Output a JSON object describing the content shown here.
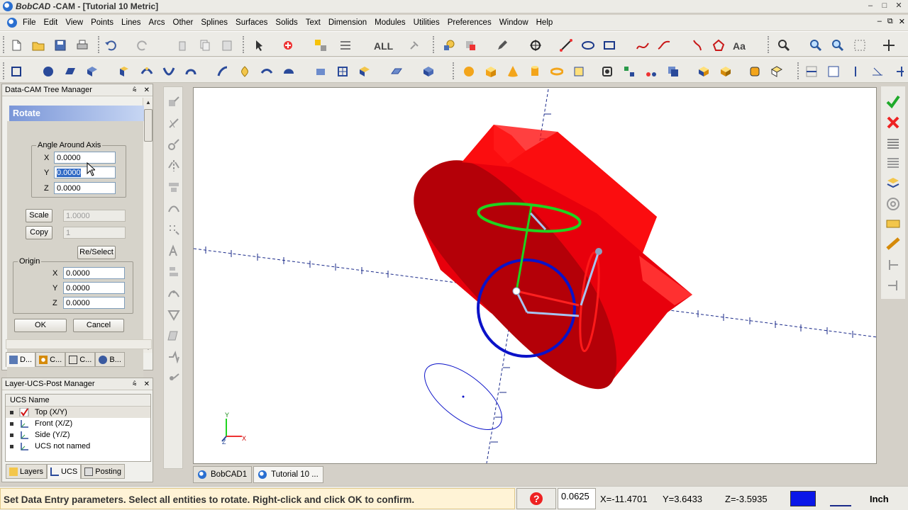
{
  "window": {
    "app_name": "BobCAD",
    "title_rest": " -CAM - [Tutorial 10 Metric]",
    "controls": [
      "–",
      "□",
      "✕"
    ],
    "mdi_controls": [
      "–",
      "⧉",
      "✕"
    ]
  },
  "menu": [
    "File",
    "Edit",
    "View",
    "Points",
    "Lines",
    "Arcs",
    "Other",
    "Splines",
    "Surfaces",
    "Solids",
    "Text",
    "Dimension",
    "Modules",
    "Utilities",
    "Preferences",
    "Window",
    "Help"
  ],
  "toolbar": {
    "all_label": "ALL",
    "text_label": "Aa"
  },
  "tree_manager": {
    "title": "Data-CAM Tree Manager",
    "pin": "⩯",
    "close": "✕",
    "rotate_title": "Rotate",
    "angle_group": "Angle Around Axis",
    "angle": {
      "x_label": "X",
      "x_value": "0.0000",
      "y_label": "Y",
      "y_value": "0.0000",
      "z_label": "Z",
      "z_value": "0.0000"
    },
    "scale_label": "Scale",
    "scale_value": "1.0000",
    "copy_label": "Copy",
    "copy_value": "1",
    "reselect_label": "Re/Select",
    "origin_group": "Origin",
    "origin": {
      "x_label": "X",
      "x_value": "0.0000",
      "y_label": "Y",
      "y_value": "0.0000",
      "z_label": "Z",
      "z_value": "0.0000"
    },
    "ok_label": "OK",
    "cancel_label": "Cancel",
    "tabs": [
      "D...",
      "C...",
      "C...",
      "B..."
    ]
  },
  "layer_manager": {
    "title": "Layer-UCS-Post Manager",
    "column": "UCS Name",
    "rows": [
      "Top (X/Y)",
      "Front (X/Z)",
      "Side (Y/Z)",
      "UCS not named"
    ],
    "tabs": [
      "Layers",
      "UCS",
      "Posting"
    ]
  },
  "document_tabs": [
    "BobCAD1",
    "Tutorial 10 ..."
  ],
  "status": {
    "message": "Set Data Entry parameters. Select all entities to rotate. Right-click and click OK to confirm.",
    "value": "0.0625",
    "x": "X=-11.4701",
    "y": "Y=3.6433",
    "z": "Z=-3.5935",
    "units": "Inch",
    "color": "#0a17e8"
  },
  "colors": {
    "model": "#e8000c",
    "gizmo_green": "#1fd41f",
    "gizmo_blue": "#0b12c8",
    "axis": "#1a2a8a"
  }
}
